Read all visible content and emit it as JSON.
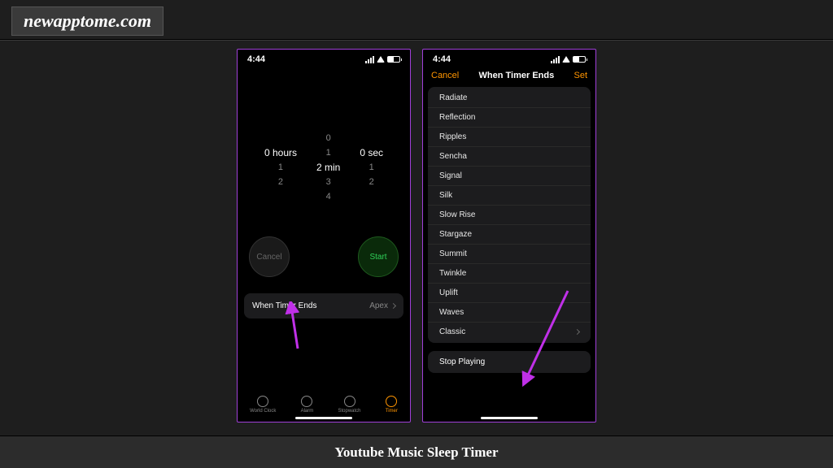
{
  "watermark": "newapptome.com",
  "caption": "Youtube Music Sleep Timer",
  "status": {
    "time": "4:44"
  },
  "phone1": {
    "picker": {
      "hours": {
        "above": "",
        "sel": "0 hours",
        "below1": "1",
        "below2": "2"
      },
      "min": {
        "above": "0",
        "above2": "1",
        "sel": "2 min",
        "below1": "3",
        "below2": "4"
      },
      "sec": {
        "above": "",
        "sel": "0 sec",
        "below1": "1",
        "below2": "2"
      }
    },
    "cancel": "Cancel",
    "start": "Start",
    "timer_ends_label": "When Timer Ends",
    "timer_ends_value": "Apex",
    "tabs": {
      "world": "World Clock",
      "alarm": "Alarm",
      "stopwatch": "Stopwatch",
      "timer": "Timer"
    }
  },
  "phone2": {
    "cancel": "Cancel",
    "title": "When Timer Ends",
    "set": "Set",
    "sounds": [
      "Radiate",
      "Reflection",
      "Ripples",
      "Sencha",
      "Signal",
      "Silk",
      "Slow Rise",
      "Stargaze",
      "Summit",
      "Twinkle",
      "Uplift",
      "Waves",
      "Classic"
    ],
    "stop_playing": "Stop Playing"
  }
}
